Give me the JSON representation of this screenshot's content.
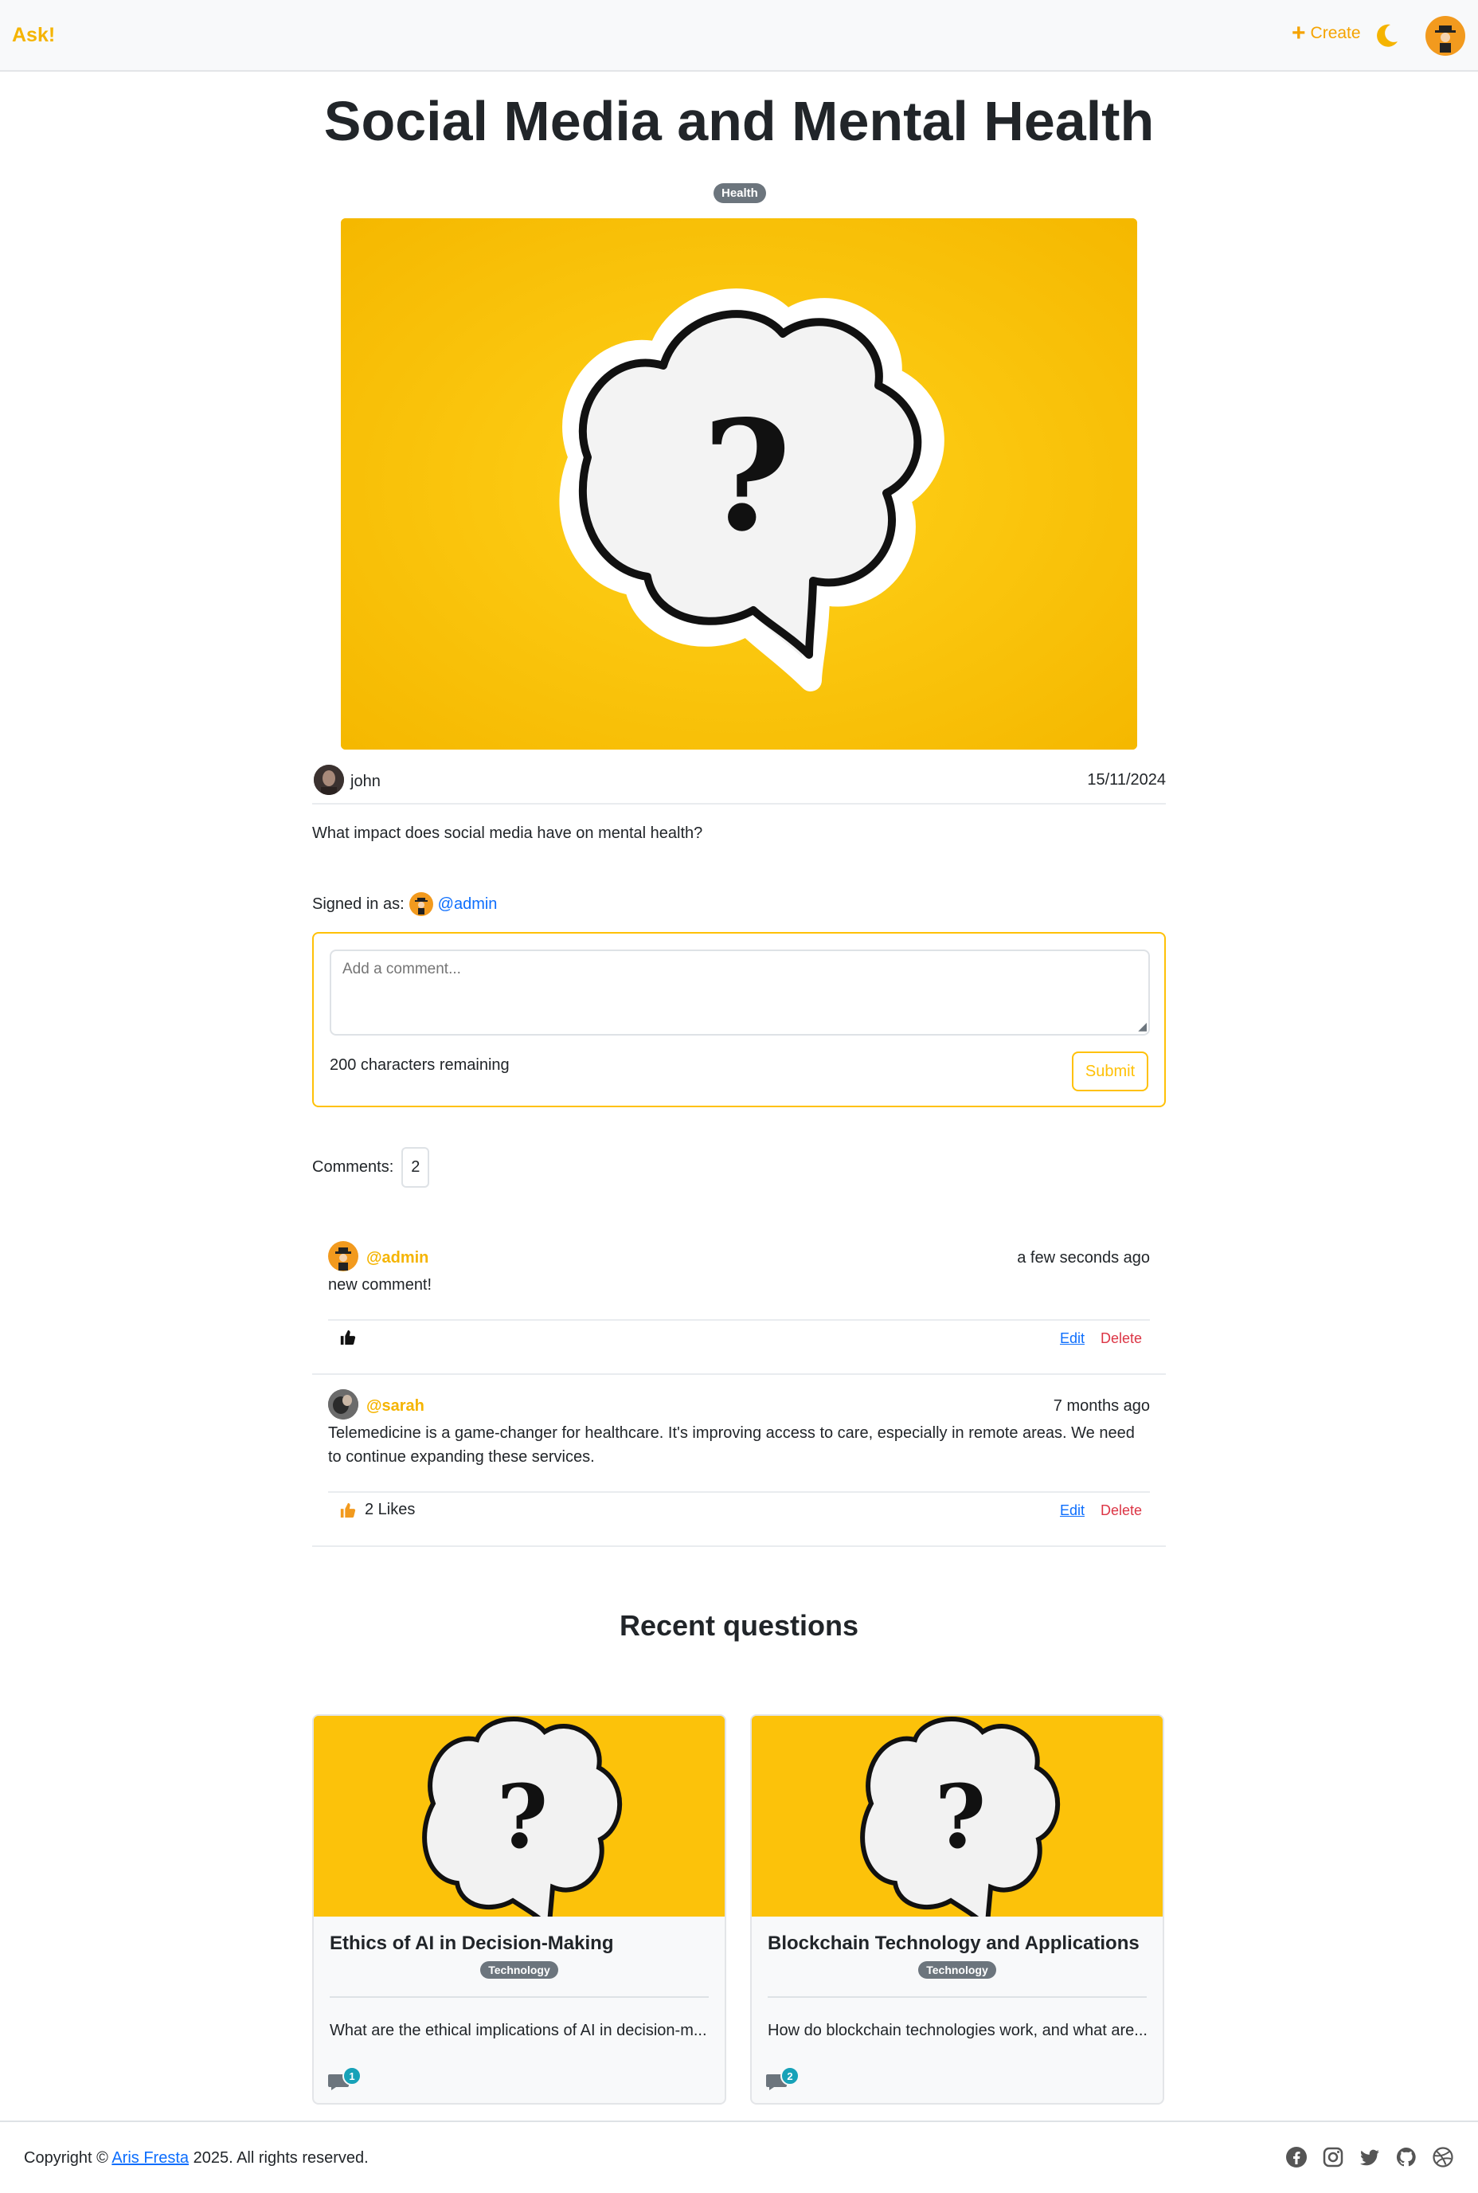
{
  "nav": {
    "brand": "Ask!",
    "create_label": "Create"
  },
  "post": {
    "title": "Social Media and Mental Health",
    "category": "Health",
    "author": "john",
    "date": "15/11/2024",
    "question": "What impact does social media have on mental health?"
  },
  "comment_form": {
    "signed_in_label": "Signed in as:",
    "user_handle": "@admin",
    "placeholder": "Add a comment...",
    "remaining": "200 characters remaining",
    "submit_label": "Submit"
  },
  "comments": {
    "label": "Comments:",
    "count": "2",
    "items": [
      {
        "handle": "@admin",
        "time": "a few seconds ago",
        "text": "new comment!",
        "likes": "",
        "edit": "Edit",
        "delete": "Delete"
      },
      {
        "handle": "@sarah",
        "time": "7 months ago",
        "text": "Telemedicine is a game-changer for healthcare. It's improving access to care, especially in remote areas. We need to continue expanding these services.",
        "likes": "2 Likes",
        "edit": "Edit",
        "delete": "Delete"
      }
    ]
  },
  "recent": {
    "heading": "Recent questions",
    "cards": [
      {
        "title": "Ethics of AI in Decision-Making",
        "category": "Technology",
        "description": "What are the ethical implications of AI in decision-m...",
        "comment_count": "1"
      },
      {
        "title": "Blockchain Technology and Applications",
        "category": "Technology",
        "description": "How do blockchain technologies work, and what are...",
        "comment_count": "2"
      }
    ]
  },
  "footer": {
    "copyright_prefix": "Copyright ©",
    "author_link": "Aris Fresta",
    "copyright_suffix": "2025. All rights reserved.",
    "social_icons": [
      "facebook-icon",
      "instagram-icon",
      "twitter-icon",
      "github-icon",
      "dribbble-icon"
    ]
  },
  "colors": {
    "accent": "#ffc107",
    "brand": "#f5b400",
    "link": "#0d6efd",
    "danger": "#dc3545",
    "badge": "#6c757d",
    "count_badge": "#17a2b8"
  }
}
